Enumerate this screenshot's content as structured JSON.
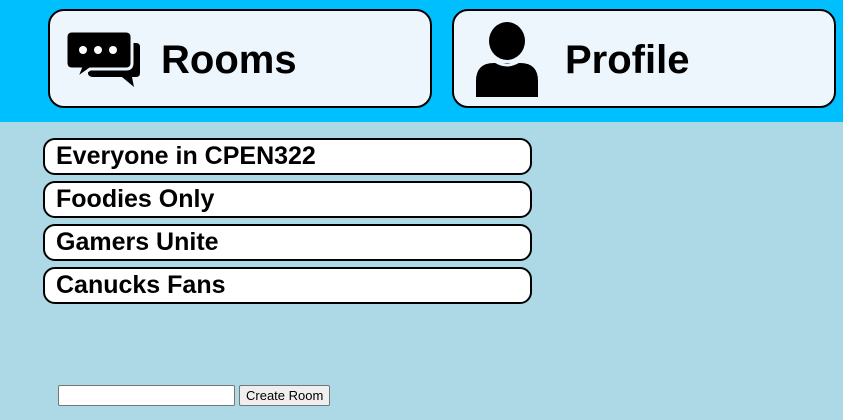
{
  "menu": {
    "rooms_label": "Rooms",
    "profile_label": "Profile",
    "rooms_icon": "chat-bubbles-icon",
    "profile_icon": "user-icon"
  },
  "rooms": [
    {
      "name": "Everyone in CPEN322"
    },
    {
      "name": "Foodies Only"
    },
    {
      "name": "Gamers Unite"
    },
    {
      "name": "Canucks Fans"
    }
  ],
  "create_room": {
    "input_value": "",
    "input_placeholder": "",
    "button_label": "Create Room"
  },
  "colors": {
    "menu_bar": "#00bfff",
    "page_background": "#add8e6",
    "menu_button": "#eef6fd",
    "room_background": "#ffffff",
    "border": "#000000"
  }
}
